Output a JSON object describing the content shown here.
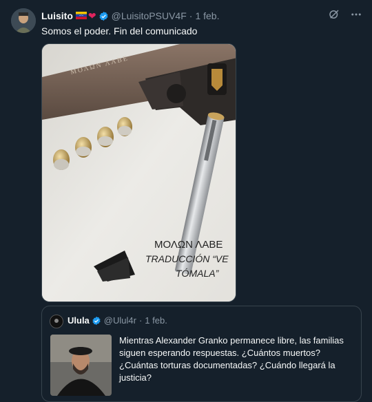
{
  "tweet": {
    "author_name": "Luisito",
    "author_handle": "@LuisitoPSUV4F",
    "separator": "·",
    "date": "1 feb.",
    "text": "Somos el poder. Fin del comunicado",
    "image_caption_line1": "ΜΟΛΩΝ ΛΑΒΕ",
    "image_caption_line2": "TRADUCCIÓN “VE",
    "image_caption_line3": "TÓMALA”",
    "engraving": "ΜΟΛΩΝ ΛΑΒΕ",
    "icons": [
      "grok-icon",
      "more-icon"
    ]
  },
  "quote": {
    "author_name": "Ulula",
    "author_handle": "@Ulul4r",
    "separator": "·",
    "date": "1 feb.",
    "text": "Mientras Alexander Granko permanece libre, las familias siguen esperando respuestas. ¿Cuántos muertos? ¿Cuántas torturas documentadas? ¿Cuándo llegará la justicia?"
  },
  "colors": {
    "background": "#15202b",
    "verified": "#1d9bf0",
    "secondary_text": "#8b98a5",
    "border": "#38444d"
  }
}
